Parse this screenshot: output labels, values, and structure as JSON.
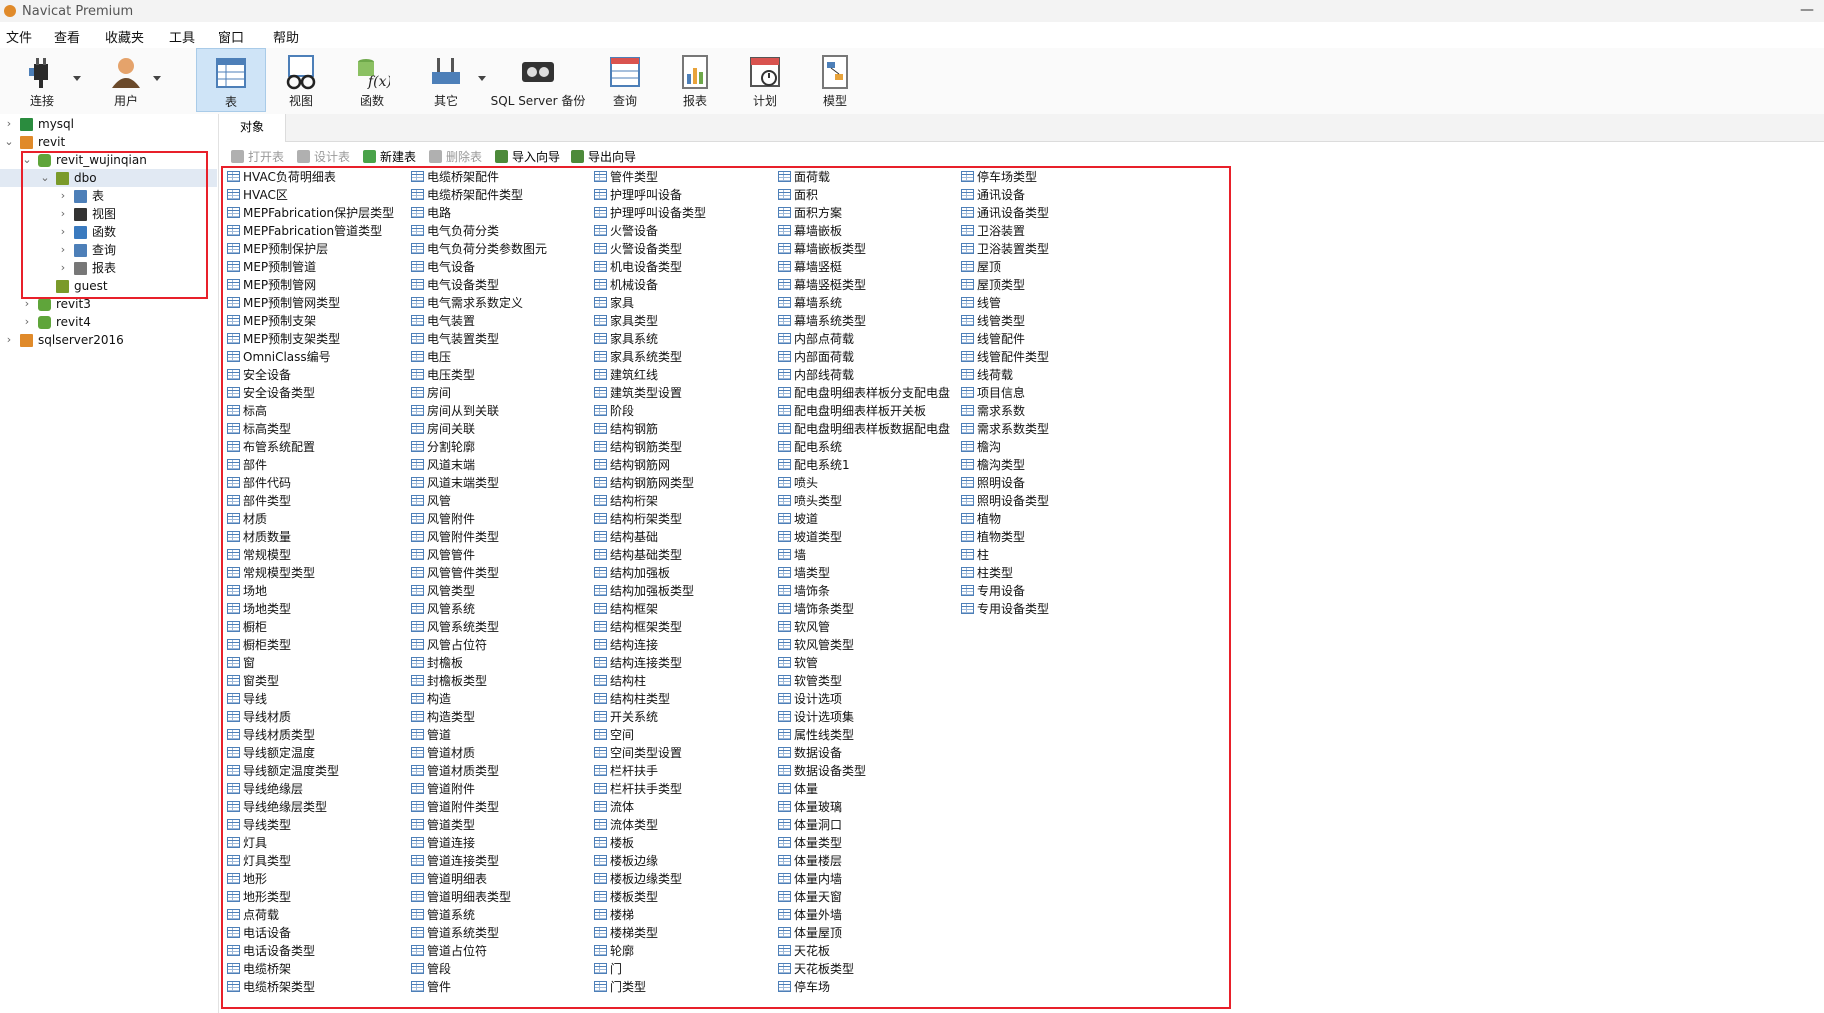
{
  "window": {
    "title": "Navicat Premium"
  },
  "menu": [
    "文件",
    "查看",
    "收藏夹",
    "工具",
    "窗口",
    "帮助"
  ],
  "toolbar": {
    "items": [
      {
        "label": "连接",
        "icon": "plug-icon"
      },
      {
        "label": "用户",
        "icon": "user-icon"
      },
      {
        "label": "表",
        "icon": "table-icon",
        "active": true
      },
      {
        "label": "视图",
        "icon": "view-icon"
      },
      {
        "label": "函数",
        "icon": "function-icon"
      },
      {
        "label": "其它",
        "icon": "tools-icon"
      },
      {
        "label": "SQL Server 备份",
        "icon": "backup-icon"
      },
      {
        "label": "查询",
        "icon": "query-icon"
      },
      {
        "label": "报表",
        "icon": "report-icon"
      },
      {
        "label": "计划",
        "icon": "schedule-icon"
      },
      {
        "label": "模型",
        "icon": "model-icon"
      }
    ]
  },
  "sidebar": {
    "tree": [
      {
        "label": "mysql",
        "icon": "mysql-connection-icon",
        "chevron": "›"
      },
      {
        "label": "revit",
        "icon": "sqlserver-connection-icon",
        "chevron": "⌄"
      },
      {
        "label": "revit_wujinqian",
        "icon": "database-icon",
        "chevron": "⌄",
        "selected": true
      },
      {
        "label": "dbo",
        "icon": "schema-icon",
        "chevron": "⌄",
        "selected": true
      },
      {
        "label": "表",
        "icon": "table-icon",
        "chevron": "›"
      },
      {
        "label": "视图",
        "icon": "view-icon",
        "chevron": "›"
      },
      {
        "label": "函数",
        "icon": "function-icon",
        "chevron": "›"
      },
      {
        "label": "查询",
        "icon": "query-icon",
        "chevron": "›"
      },
      {
        "label": "报表",
        "icon": "report-icon",
        "chevron": "›"
      },
      {
        "label": "guest",
        "icon": "schema-icon",
        "chevron": ""
      },
      {
        "label": "revit3",
        "icon": "database-icon",
        "chevron": "›"
      },
      {
        "label": "revit4",
        "icon": "database-icon",
        "chevron": "›"
      },
      {
        "label": "sqlserver2016",
        "icon": "sqlserver-connection-icon",
        "chevron": "›"
      }
    ]
  },
  "tab": {
    "label": "对象"
  },
  "object_toolbar": [
    {
      "label": "打开表",
      "icon": "open-table-icon",
      "enabled": false
    },
    {
      "label": "设计表",
      "icon": "design-table-icon",
      "enabled": false
    },
    {
      "label": "新建表",
      "icon": "new-table-icon",
      "enabled": true
    },
    {
      "label": "删除表",
      "icon": "delete-table-icon",
      "enabled": false
    },
    {
      "label": "导入向导",
      "icon": "import-wizard-icon",
      "enabled": true
    },
    {
      "label": "导出向导",
      "icon": "export-wizard-icon",
      "enabled": true
    }
  ],
  "tables": [
    [
      "HVAC负荷明细表",
      "HVAC区",
      "MEPFabrication保护层类型",
      "MEPFabrication管道类型",
      "MEP预制保护层",
      "MEP预制管道",
      "MEP预制管网",
      "MEP预制管网类型",
      "MEP预制支架",
      "MEP预制支架类型",
      "OmniClass编号",
      "安全设备",
      "安全设备类型",
      "标高",
      "标高类型",
      "布管系统配置",
      "部件",
      "部件代码",
      "部件类型",
      "材质",
      "材质数量",
      "常规模型",
      "常规模型类型",
      "场地",
      "场地类型",
      "橱柜",
      "橱柜类型",
      "窗",
      "窗类型",
      "导线",
      "导线材质",
      "导线材质类型",
      "导线额定温度",
      "导线额定温度类型",
      "导线绝缘层",
      "导线绝缘层类型",
      "导线类型",
      "灯具",
      "灯具类型",
      "地形",
      "地形类型",
      "点荷载",
      "电话设备",
      "电话设备类型",
      "电缆桥架",
      "电缆桥架类型"
    ],
    [
      "电缆桥架配件",
      "电缆桥架配件类型",
      "电路",
      "电气负荷分类",
      "电气负荷分类参数图元",
      "电气设备",
      "电气设备类型",
      "电气需求系数定义",
      "电气装置",
      "电气装置类型",
      "电压",
      "电压类型",
      "房间",
      "房间从到关联",
      "房间关联",
      "分割轮廓",
      "风道末端",
      "风道末端类型",
      "风管",
      "风管附件",
      "风管附件类型",
      "风管管件",
      "风管管件类型",
      "风管类型",
      "风管系统",
      "风管系统类型",
      "风管占位符",
      "封檐板",
      "封檐板类型",
      "构造",
      "构造类型",
      "管道",
      "管道材质",
      "管道材质类型",
      "管道附件",
      "管道附件类型",
      "管道类型",
      "管道连接",
      "管道连接类型",
      "管道明细表",
      "管道明细表类型",
      "管道系统",
      "管道系统类型",
      "管道占位符",
      "管段",
      "管件"
    ],
    [
      "管件类型",
      "护理呼叫设备",
      "护理呼叫设备类型",
      "火警设备",
      "火警设备类型",
      "机电设备类型",
      "机械设备",
      "家具",
      "家具类型",
      "家具系统",
      "家具系统类型",
      "建筑红线",
      "建筑类型设置",
      "阶段",
      "结构钢筋",
      "结构钢筋类型",
      "结构钢筋网",
      "结构钢筋网类型",
      "结构桁架",
      "结构桁架类型",
      "结构基础",
      "结构基础类型",
      "结构加强板",
      "结构加强板类型",
      "结构框架",
      "结构框架类型",
      "结构连接",
      "结构连接类型",
      "结构柱",
      "结构柱类型",
      "开关系统",
      "空间",
      "空间类型设置",
      "栏杆扶手",
      "栏杆扶手类型",
      "流体",
      "流体类型",
      "楼板",
      "楼板边缘",
      "楼板边缘类型",
      "楼板类型",
      "楼梯",
      "楼梯类型",
      "轮廓",
      "门",
      "门类型"
    ],
    [
      "面荷载",
      "面积",
      "面积方案",
      "幕墙嵌板",
      "幕墙嵌板类型",
      "幕墙竖梃",
      "幕墙竖梃类型",
      "幕墙系统",
      "幕墙系统类型",
      "内部点荷载",
      "内部面荷载",
      "内部线荷载",
      "配电盘明细表样板分支配电盘",
      "配电盘明细表样板开关板",
      "配电盘明细表样板数据配电盘",
      "配电系统",
      "配电系统1",
      "喷头",
      "喷头类型",
      "坡道",
      "坡道类型",
      "墙",
      "墙类型",
      "墙饰条",
      "墙饰条类型",
      "软风管",
      "软风管类型",
      "软管",
      "软管类型",
      "设计选项",
      "设计选项集",
      "属性线类型",
      "数据设备",
      "数据设备类型",
      "体量",
      "体量玻璃",
      "体量洞口",
      "体量类型",
      "体量楼层",
      "体量内墙",
      "体量天窗",
      "体量外墙",
      "体量屋顶",
      "天花板",
      "天花板类型",
      "停车场"
    ],
    [
      "停车场类型",
      "通讯设备",
      "通讯设备类型",
      "卫浴装置",
      "卫浴装置类型",
      "屋顶",
      "屋顶类型",
      "线管",
      "线管类型",
      "线管配件",
      "线管配件类型",
      "线荷载",
      "项目信息",
      "需求系数",
      "需求系数类型",
      "檐沟",
      "檐沟类型",
      "照明设备",
      "照明设备类型",
      "植物",
      "植物类型",
      "柱",
      "柱类型",
      "专用设备",
      "专用设备类型"
    ]
  ]
}
